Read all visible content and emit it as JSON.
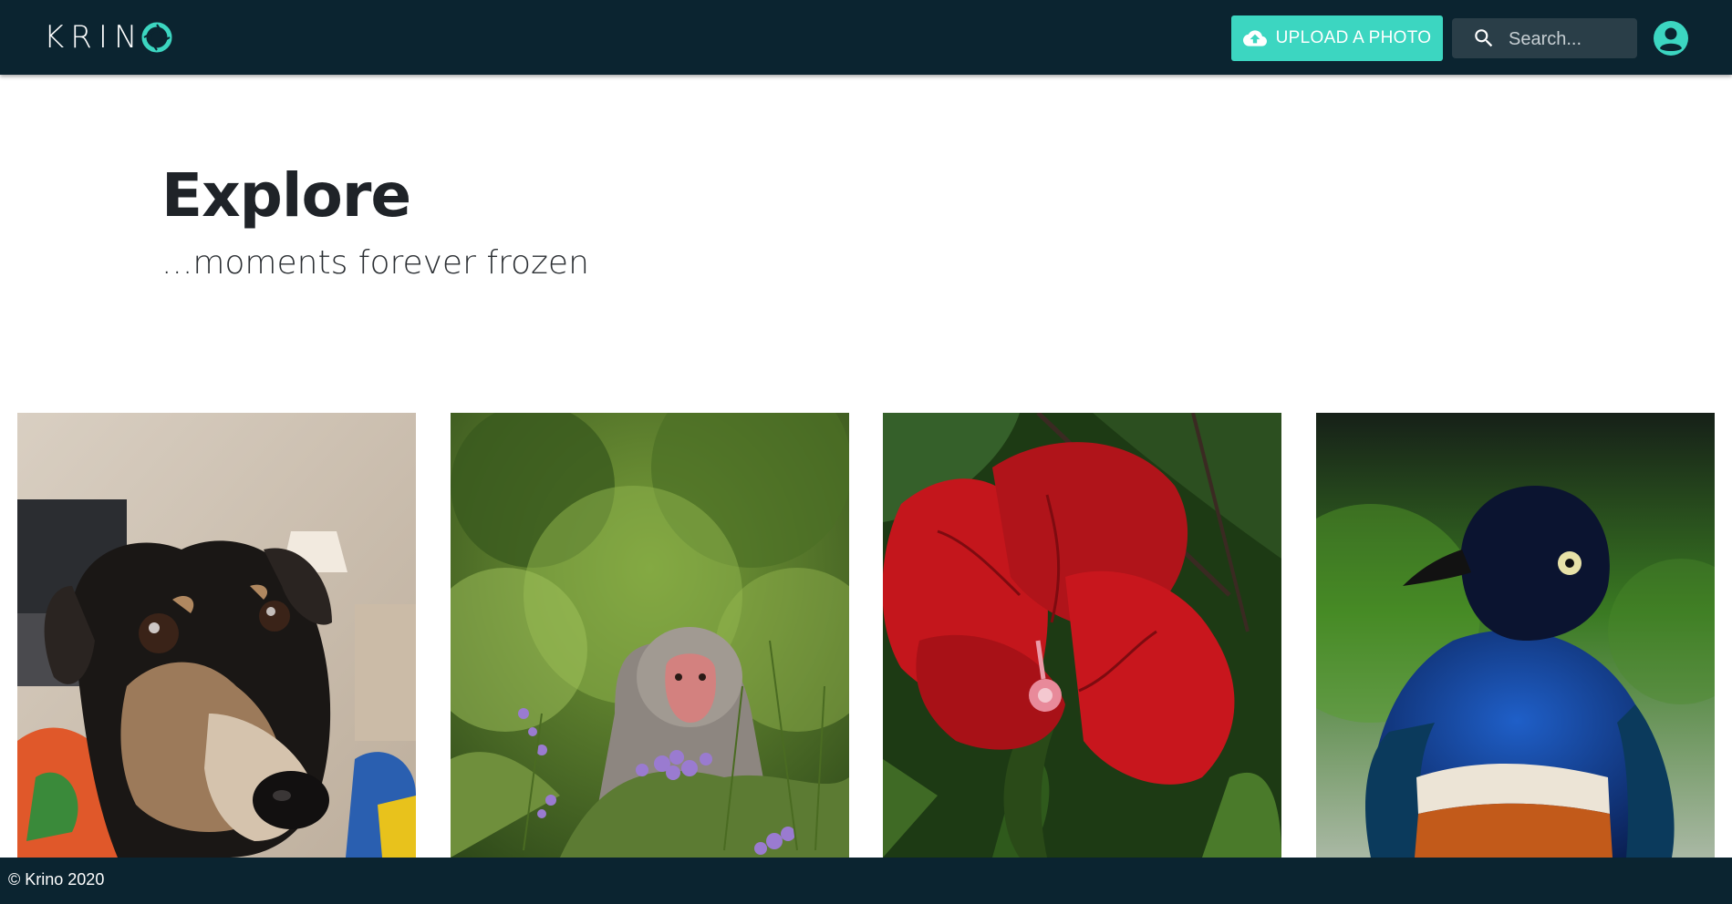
{
  "header": {
    "logo_text": "KRIN",
    "upload_label": "UPLOAD A PHOTO",
    "search_placeholder": "Search...",
    "accent_color": "#3cd6c1",
    "bar_color": "#0b2430"
  },
  "hero": {
    "title": "Explore",
    "subtitle": "...moments forever frozen"
  },
  "gallery": {
    "photos": [
      {
        "subject": "dog"
      },
      {
        "subject": "snow monkey"
      },
      {
        "subject": "red hibiscus flower"
      },
      {
        "subject": "superb starling bird"
      }
    ]
  },
  "footer": {
    "copyright": "© Krino 2020"
  }
}
